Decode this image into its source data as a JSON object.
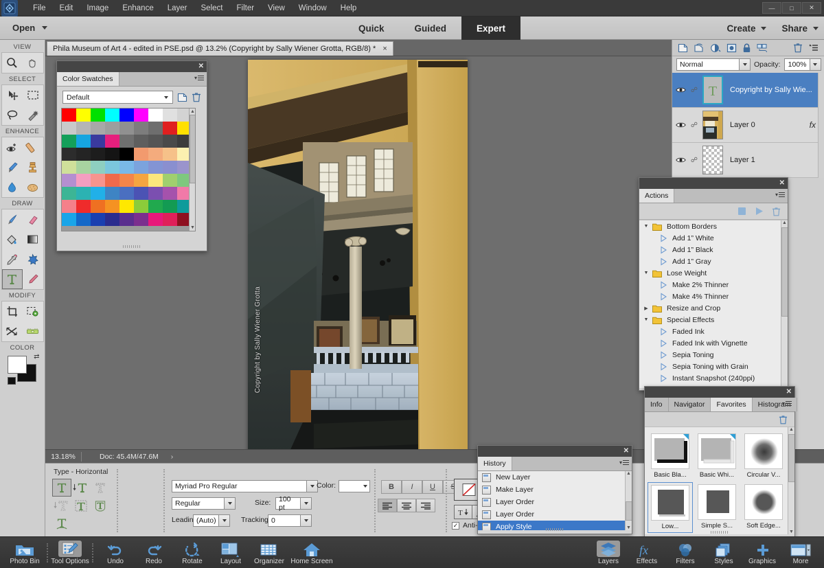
{
  "window": {
    "title_icons": [
      "minimize",
      "maximize",
      "close"
    ],
    "menu": [
      "File",
      "Edit",
      "Image",
      "Enhance",
      "Layer",
      "Select",
      "Filter",
      "View",
      "Window",
      "Help"
    ]
  },
  "modebar": {
    "open_label": "Open",
    "modes": [
      {
        "label": "Quick",
        "active": false
      },
      {
        "label": "Guided",
        "active": false
      },
      {
        "label": "Expert",
        "active": true
      }
    ],
    "create_label": "Create",
    "share_label": "Share"
  },
  "document": {
    "tab_title": "Phila Museum of Art 4 - edited in PSE.psd @ 13.2% (Copyright by Sally Wiener Grotta, RGB/8) *",
    "close_glyph": "×",
    "watermark": "Copyright by Sally Wiener Grotta"
  },
  "statusbar": {
    "zoom": "13.18%",
    "doc_info": "Doc: 45.4M/47.6M",
    "arrow": "›"
  },
  "toolbar": {
    "groups": [
      {
        "label": "VIEW",
        "tools": [
          {
            "name": "zoom-tool",
            "selected": false
          },
          {
            "name": "hand-tool",
            "selected": false
          }
        ]
      },
      {
        "label": "SELECT",
        "tools": [
          {
            "name": "move-tool",
            "selected": false
          },
          {
            "name": "rectangular-marquee-tool",
            "selected": false
          },
          {
            "name": "lasso-tool",
            "selected": false
          },
          {
            "name": "quick-selection-tool",
            "selected": false
          }
        ]
      },
      {
        "label": "ENHANCE",
        "tools": [
          {
            "name": "redeye-removal-tool",
            "selected": false
          },
          {
            "name": "spot-healing-tool",
            "selected": false
          },
          {
            "name": "smart-brush-tool",
            "selected": false
          },
          {
            "name": "clone-stamp-tool",
            "selected": false
          },
          {
            "name": "blur-tool",
            "selected": false
          },
          {
            "name": "sponge-tool",
            "selected": false
          }
        ]
      },
      {
        "label": "DRAW",
        "tools": [
          {
            "name": "brush-tool",
            "selected": false
          },
          {
            "name": "eraser-tool",
            "selected": false
          },
          {
            "name": "paint-bucket-tool",
            "selected": false
          },
          {
            "name": "gradient-tool",
            "selected": false
          },
          {
            "name": "eyedropper-tool",
            "selected": false
          },
          {
            "name": "custom-shape-tool",
            "selected": false
          },
          {
            "name": "type-tool",
            "selected": true
          },
          {
            "name": "pencil-tool",
            "selected": false
          }
        ]
      },
      {
        "label": "MODIFY",
        "tools": [
          {
            "name": "crop-tool",
            "selected": false
          },
          {
            "name": "recompose-tool",
            "selected": false
          },
          {
            "name": "content-aware-move-tool",
            "selected": false
          },
          {
            "name": "straighten-tool",
            "selected": false
          }
        ]
      },
      {
        "label": "COLOR",
        "tools": []
      }
    ],
    "color": {
      "foreground": "#ffffff",
      "background": "#111111"
    }
  },
  "color_swatches": {
    "panel_title": "Color Swatches",
    "preset": "Default",
    "rows": [
      [
        "#ff0000",
        "#ffff00",
        "#00e000",
        "#00ffff",
        "#0000ff",
        "#ff00ff",
        "#ffffff",
        "#e0e0e0",
        "#d3d3d3"
      ],
      [
        "#c9c9c9",
        "#b5b5b5",
        "#a8a8a8",
        "#9e9e9e",
        "#909090",
        "#7d7d7d",
        "#6e6e6e",
        "#e02020",
        "#ffe000"
      ],
      [
        "#14a05a",
        "#16a5e0",
        "#3a3a9e",
        "#e61f7d",
        "#6f6f6f",
        "#5e5e5e",
        "#555555",
        "#4a4a4a",
        "#3c3c3c"
      ],
      [
        "#2c2c2c",
        "#242424",
        "#1d1d1d",
        "#141414",
        "#000000",
        "#f29a6e",
        "#f4ab7d",
        "#f6c189",
        "#fcf0b0"
      ],
      [
        "#cfe09a",
        "#a8d3a0",
        "#8ecfc0",
        "#7bc6dd",
        "#79b8e8",
        "#7ba3dd",
        "#8394d4",
        "#8a8fcf",
        "#9a94cc"
      ],
      [
        "#b48fd0",
        "#f59ec0",
        "#f6948e",
        "#f06a4b",
        "#f4854a",
        "#f5a541",
        "#fbe77c",
        "#a0cf6e",
        "#7ec87e"
      ],
      [
        "#3cb595",
        "#2cb2b2",
        "#21b0e8",
        "#3e84c4",
        "#4a6fc0",
        "#4b53b4",
        "#7b4fb0",
        "#a552ac",
        "#f17aa8"
      ],
      [
        "#f4808a",
        "#ef2b2b",
        "#ef7022",
        "#f59222",
        "#ffe800",
        "#8ccc3a",
        "#21a94e",
        "#139b53",
        "#0e9b9b"
      ],
      [
        "#1aa5e8",
        "#1468c8",
        "#1a3fb0",
        "#2a2c8e",
        "#5a2f8e",
        "#7b2f8e",
        "#e8187a",
        "#e0205a",
        "#8e1020"
      ]
    ]
  },
  "actions": {
    "panel_title": "Actions",
    "toolbar_icons": [
      "stop-icon",
      "play-icon",
      "trash-icon"
    ],
    "items": [
      {
        "label": "Bottom Borders",
        "type": "folder",
        "expanded": true
      },
      {
        "label": "Add 1” White",
        "type": "action"
      },
      {
        "label": "Add 1” Black",
        "type": "action"
      },
      {
        "label": "Add 1” Gray",
        "type": "action"
      },
      {
        "label": "Lose Weight",
        "type": "folder",
        "expanded": true
      },
      {
        "label": "Make 2% Thinner",
        "type": "action"
      },
      {
        "label": "Make 4% Thinner",
        "type": "action"
      },
      {
        "label": "Resize and Crop",
        "type": "folder",
        "expanded": false
      },
      {
        "label": "Special Effects",
        "type": "folder",
        "expanded": true
      },
      {
        "label": "Faded Ink",
        "type": "action"
      },
      {
        "label": "Faded Ink with Vignette",
        "type": "action"
      },
      {
        "label": "Sepia Toning",
        "type": "action"
      },
      {
        "label": "Sepia Toning with Grain",
        "type": "action"
      },
      {
        "label": "Instant Snapshot (240ppi)",
        "type": "action"
      }
    ]
  },
  "favorites": {
    "tabs": [
      {
        "label": "Info",
        "active": false
      },
      {
        "label": "Navigator",
        "active": false
      },
      {
        "label": "Favorites",
        "active": true
      },
      {
        "label": "Histogram",
        "active": false
      }
    ],
    "trash_icon": "trash-icon",
    "items": [
      {
        "label": "Basic Bla...",
        "kind": "frame-black",
        "selected": false
      },
      {
        "label": "Basic Whi...",
        "kind": "frame-white",
        "selected": false
      },
      {
        "label": "Circular V...",
        "kind": "vignette",
        "selected": false
      },
      {
        "label": "Low...",
        "kind": "swatch",
        "selected": true
      },
      {
        "label": "Simple S...",
        "kind": "swatch",
        "selected": false
      },
      {
        "label": "Soft Edge...",
        "kind": "swatch-soft",
        "selected": false
      }
    ]
  },
  "history": {
    "panel_title": "History",
    "items": [
      {
        "label": "New Layer",
        "selected": false
      },
      {
        "label": "Make Layer",
        "selected": false
      },
      {
        "label": "Layer Order",
        "selected": false
      },
      {
        "label": "Layer Order",
        "selected": false
      },
      {
        "label": "Apply Style",
        "selected": true
      }
    ]
  },
  "layers": {
    "toolbar_icons": [
      "new-layer-icon",
      "duplicate-layer-icon",
      "adjustment-layer-icon",
      "layer-mask-icon",
      "lock-icon",
      "group-layer-icon",
      "trash-icon",
      "panel-menu-icon"
    ],
    "blend_mode": "Normal",
    "opacity_label": "Opacity:",
    "opacity_value": "100%",
    "rows": [
      {
        "name": "Copyright by Sally Wie...",
        "kind": "type",
        "selected": true,
        "fx": false,
        "visible": true
      },
      {
        "name": "Layer 0",
        "kind": "image",
        "selected": false,
        "fx": true,
        "visible": true
      },
      {
        "name": "Layer 1",
        "kind": "empty",
        "selected": false,
        "fx": false,
        "visible": true
      }
    ],
    "fx_glyph": "fx"
  },
  "options_bar": {
    "tool_label": "Type - Horizontal",
    "font_family": "Myriad Pro Regular",
    "font_style": "Regular",
    "size_label": "Size:",
    "size_value": "100 pt",
    "leading_label": "Leading:",
    "leading_value": "(Auto)",
    "tracking_label": "Tracking:",
    "tracking_value": "0",
    "color_label": "Color:",
    "style_buttons": [
      "B",
      "I",
      "U",
      "S"
    ],
    "align_buttons": [
      "align-left",
      "align-center",
      "align-right"
    ],
    "orientation_icon": "text-orientation-icon",
    "warp_icon": "warp-text-icon",
    "antialias_label": "Anti-aliasing",
    "antialias_checked": true,
    "type_mode_icons": [
      "horizontal-type-tool",
      "vertical-type-tool",
      "horizontal-type-mask-tool",
      "vertical-type-mask-tool",
      "text-on-selection-tool",
      "text-on-shape-tool",
      "text-on-custom-path-tool"
    ]
  },
  "taskbar": {
    "left_items": [
      {
        "label": "Photo Bin",
        "icon": "photo-bin-icon",
        "selected": false
      },
      {
        "label": "Tool Options",
        "icon": "tool-options-icon",
        "selected": true
      },
      {
        "label": "Undo",
        "icon": "undo-icon",
        "selected": false
      },
      {
        "label": "Redo",
        "icon": "redo-icon",
        "selected": false
      },
      {
        "label": "Rotate",
        "icon": "rotate-icon",
        "selected": false
      },
      {
        "label": "Layout",
        "icon": "layout-icon",
        "selected": false
      },
      {
        "label": "Organizer",
        "icon": "organizer-icon",
        "selected": false
      },
      {
        "label": "Home Screen",
        "icon": "home-icon",
        "selected": false
      }
    ],
    "right_items": [
      {
        "label": "Layers",
        "icon": "layers-icon",
        "selected": true
      },
      {
        "label": "Effects",
        "icon": "effects-icon",
        "selected": false
      },
      {
        "label": "Filters",
        "icon": "filters-icon",
        "selected": false
      },
      {
        "label": "Styles",
        "icon": "styles-icon",
        "selected": false
      },
      {
        "label": "Graphics",
        "icon": "graphics-icon",
        "selected": false
      },
      {
        "label": "More",
        "icon": "more-icon",
        "selected": false
      }
    ]
  },
  "colors": {
    "accent_blue": "#3c78c8",
    "panel_gray": "#d0d0d0",
    "dark_chrome": "#3a3a3a",
    "canvas_gray": "#6e6e6e"
  }
}
